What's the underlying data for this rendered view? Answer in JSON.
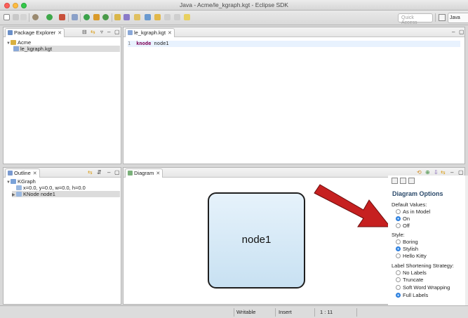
{
  "window": {
    "title": "Java - Acme/le_kgraph.kgt - Eclipse SDK"
  },
  "toolbar": {
    "quick_access_placeholder": "Quick Access",
    "perspective_label": "Java"
  },
  "package_explorer": {
    "tab_label": "Package Explorer",
    "tree": [
      {
        "label": "Acme",
        "icon": "project-folder-icon",
        "expanded": true
      },
      {
        "label": "le_kgraph.kgt",
        "icon": "kgt-file-icon"
      }
    ]
  },
  "editor": {
    "tab_label": "le_kgraph.kgt",
    "line_number": "1",
    "keyword": "knode",
    "text": " node1"
  },
  "outline": {
    "tab_label": "Outline",
    "tree": [
      {
        "label": "KGraph",
        "icon": "kgraph-icon",
        "expanded": true
      },
      {
        "label": "x=0.0, y=0.0, w=0.0, h=0.0",
        "icon": "shape-layout-icon"
      },
      {
        "label": "KNode node1",
        "icon": "knode-icon",
        "selected": true
      }
    ]
  },
  "diagram": {
    "tab_label": "Diagram",
    "node_label": "node1"
  },
  "diagram_options": {
    "title": "Diagram Options",
    "groups": [
      {
        "label": "Default Values:",
        "options": [
          {
            "label": "As in Model",
            "selected": false
          },
          {
            "label": "On",
            "selected": true
          },
          {
            "label": "Off",
            "selected": false
          }
        ]
      },
      {
        "label": "Style:",
        "options": [
          {
            "label": "Boring",
            "selected": false
          },
          {
            "label": "Stylish",
            "selected": true
          },
          {
            "label": "Hello Kitty",
            "selected": false
          }
        ]
      },
      {
        "label": "Label Shortening Strategy:",
        "options": [
          {
            "label": "No Labels",
            "selected": false
          },
          {
            "label": "Truncate",
            "selected": false
          },
          {
            "label": "Soft Word Wrapping",
            "selected": false
          },
          {
            "label": "Full Labels",
            "selected": true
          }
        ]
      }
    ]
  },
  "statusbar": {
    "writable": "Writable",
    "mode": "Insert",
    "position": "1 : 11"
  },
  "colors": {
    "accent_arrow": "#c62020",
    "node_fill": "#d6eaf8",
    "selection": "#dcdcdc"
  }
}
